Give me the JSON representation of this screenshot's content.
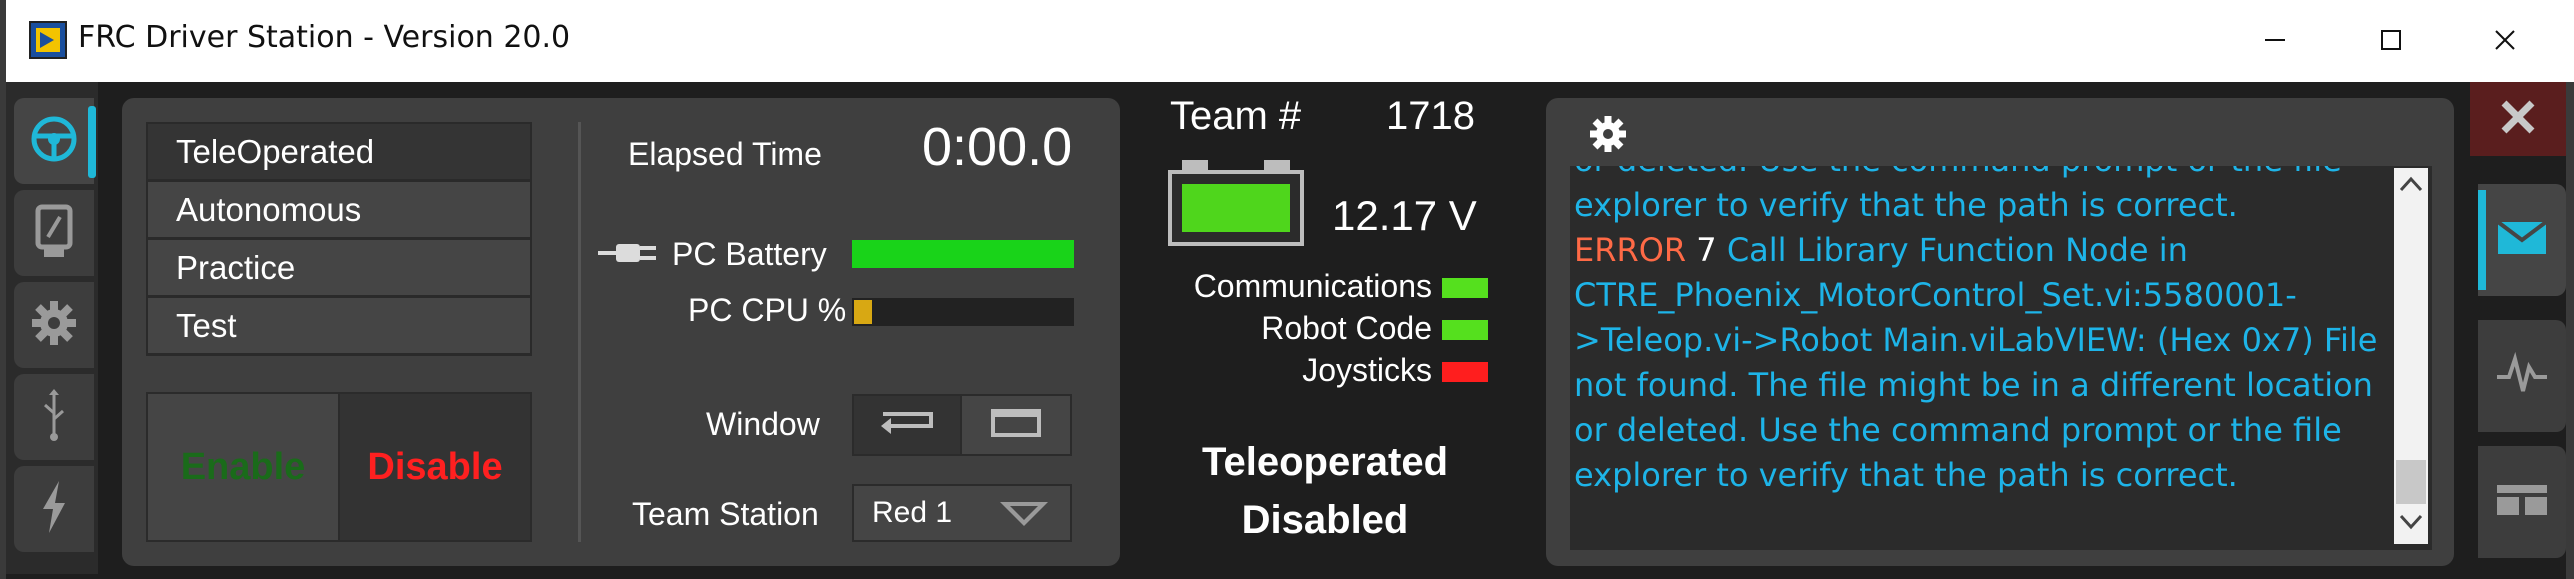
{
  "window": {
    "title": "FRC Driver Station - Version 20.0"
  },
  "left_tabs": [
    {
      "icon": "steering-wheel-icon",
      "active": true
    },
    {
      "icon": "diagnostics-icon",
      "active": false
    },
    {
      "icon": "gear-icon",
      "active": false
    },
    {
      "icon": "usb-icon",
      "active": false
    },
    {
      "icon": "power-icon",
      "active": false
    }
  ],
  "modes": [
    "TeleOperated",
    "Autonomous",
    "Practice",
    "Test"
  ],
  "selected_mode": "TeleOperated",
  "enable_label": "Enable",
  "disable_label": "Disable",
  "elapsed": {
    "label": "Elapsed Time",
    "value": "0:00.0"
  },
  "pc_battery": {
    "label": "PC Battery",
    "level": 1.0
  },
  "pc_cpu": {
    "label": "PC CPU %",
    "level": 0.1
  },
  "window_label": "Window",
  "team_station": {
    "label": "Team Station",
    "value": "Red 1"
  },
  "team": {
    "label": "Team #",
    "number": "1718"
  },
  "battery_voltage": "12.17 V",
  "indicators": {
    "communications": {
      "label": "Communications",
      "color": "#55e01e"
    },
    "robot_code": {
      "label": "Robot Code",
      "color": "#55e01e"
    },
    "joysticks": {
      "label": "Joysticks",
      "color": "#ff1e1e"
    }
  },
  "status": {
    "line1": "Teleoperated",
    "line2": "Disabled"
  },
  "messages": {
    "line0": "or deleted. Use the command prompt or the file",
    "line1": "explorer to verify that the path is correct.",
    "error_tag": "ERROR",
    "error_code": "7",
    "error_text_a": "Call Library Function Node in",
    "line3": "CTRE_Phoenix_MotorControl_Set.vi:5580001-",
    "line4": ">Teleop.vi->Robot Main.viLabVIEW: (Hex 0x7) File",
    "line5": "not found. The file might be in a different location",
    "line6": "or deleted. Use the command prompt or the file",
    "line7": "explorer to verify that the path is correct."
  },
  "colors": {
    "accent": "#1fb8d8",
    "message_text": "#1eb4e8",
    "error": "#ff6a46"
  }
}
